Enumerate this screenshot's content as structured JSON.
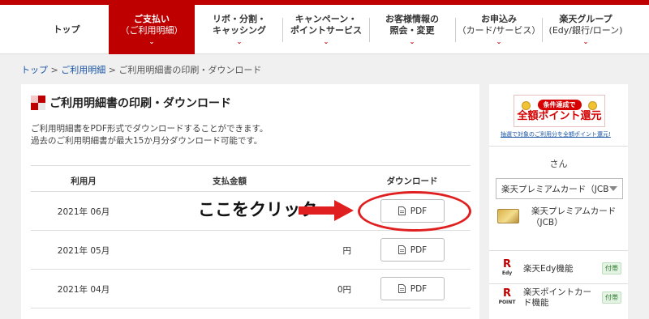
{
  "nav": {
    "items": [
      {
        "line1": "トップ",
        "line2": "",
        "active": false
      },
      {
        "line1": "ご支払い",
        "line2": "（ご利用明細）",
        "active": true
      },
      {
        "line1": "リボ・分割・",
        "line2": "キャッシング",
        "active": false
      },
      {
        "line1": "キャンペーン・",
        "line2": "ポイントサービス",
        "active": false
      },
      {
        "line1": "お客様情報の",
        "line2": "照会・変更",
        "active": false
      },
      {
        "line1": "お申込み",
        "line2": "（カード/サービス）",
        "active": false
      },
      {
        "line1": "楽天グループ",
        "line2": "(Edy/銀行/ローン)",
        "active": false
      }
    ],
    "chevron": "⌄"
  },
  "breadcrumb": {
    "top": "トップ",
    "sep": " > ",
    "statements": "ご利用明細",
    "current": "ご利用明細書の印刷・ダウンロード"
  },
  "main": {
    "title": "ご利用明細書の印刷・ダウンロード",
    "desc_line1": "ご利用明細書をPDF形式でダウンロードすることができます。",
    "desc_line2": "過去のご利用明細書が最大15か月分ダウンロード可能です。",
    "table": {
      "headers": {
        "month": "利用月",
        "amount": "支払金額",
        "download": "ダウンロード"
      },
      "rows": [
        {
          "month": "2021年 06月",
          "amount": "",
          "button": "PDF"
        },
        {
          "month": "2021年 05月",
          "amount": "円",
          "button": "PDF"
        },
        {
          "month": "2021年 04月",
          "amount": "0円",
          "button": "PDF"
        }
      ]
    }
  },
  "annotation": {
    "text": "ここをクリック",
    "color": "#e02020"
  },
  "sidebar": {
    "banner_top": "条件達成で",
    "banner_main": "全額ポイント還元",
    "banner_link": "抽選で対象のご利用分を全額ポイント還元!",
    "san": "さん",
    "card_select_value": "楽天プレミアムカード（JCB",
    "card_name": "楽天プレミアムカード（JCB）",
    "features": [
      {
        "logo": "R",
        "logo_sub": "Edy",
        "label": "楽天Edy機能",
        "badge": "付帯"
      },
      {
        "logo": "R",
        "logo_sub": "POINT",
        "label": "楽天ポイントカード機能",
        "badge": "付帯"
      }
    ]
  },
  "colors": {
    "brand": "#bf0000",
    "link": "#1a55a6",
    "badge_green": "#2c7a2c"
  },
  "icons": {
    "pdf": "document-icon",
    "chevron": "chevron-down-icon",
    "caret": "dropdown-caret-icon"
  }
}
